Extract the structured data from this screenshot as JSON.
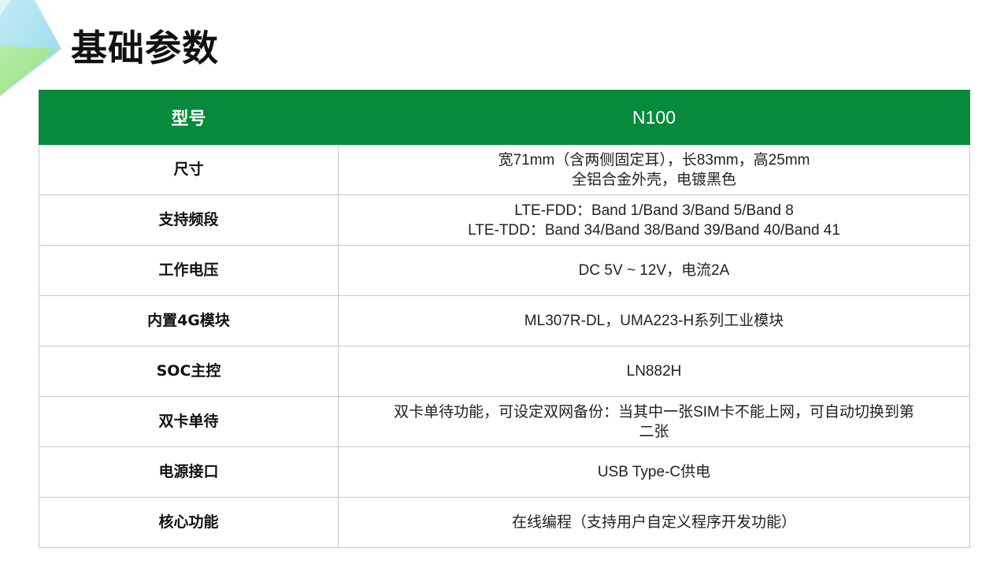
{
  "page": {
    "title": "基础参数",
    "colors": {
      "header_bg": "#078a3b",
      "header_text": "#ffffff",
      "border": "#c9c9c9"
    }
  },
  "table": {
    "header": {
      "key": "型号",
      "value": "N100"
    },
    "rows": [
      {
        "key": "尺寸",
        "lines": [
          "宽71mm（含两侧固定耳），长83mm，高25mm",
          "全铝合金外壳，电镀黑色"
        ]
      },
      {
        "key": "支持频段",
        "lines": [
          "LTE-FDD：Band 1/Band 3/Band 5/Band 8",
          "LTE-TDD：Band 34/Band 38/Band 39/Band 40/Band 41"
        ]
      },
      {
        "key": "工作电压",
        "lines": [
          "DC 5V ~ 12V，电流2A"
        ]
      },
      {
        "key": "内置4G模块",
        "lines": [
          "ML307R-DL，UMA223-H系列工业模块"
        ]
      },
      {
        "key": "SOC主控",
        "lines": [
          "LN882H"
        ]
      },
      {
        "key": "双卡单待",
        "lines": [
          "双卡单待功能，可设定双网备份：当其中一张SIM卡不能上网，可自动切换到第",
          "二张"
        ]
      },
      {
        "key": "电源接口",
        "lines": [
          "USB Type-C供电"
        ]
      },
      {
        "key": "核心功能",
        "lines": [
          "在线编程（支持用户自定义程序开发功能）"
        ]
      }
    ]
  }
}
